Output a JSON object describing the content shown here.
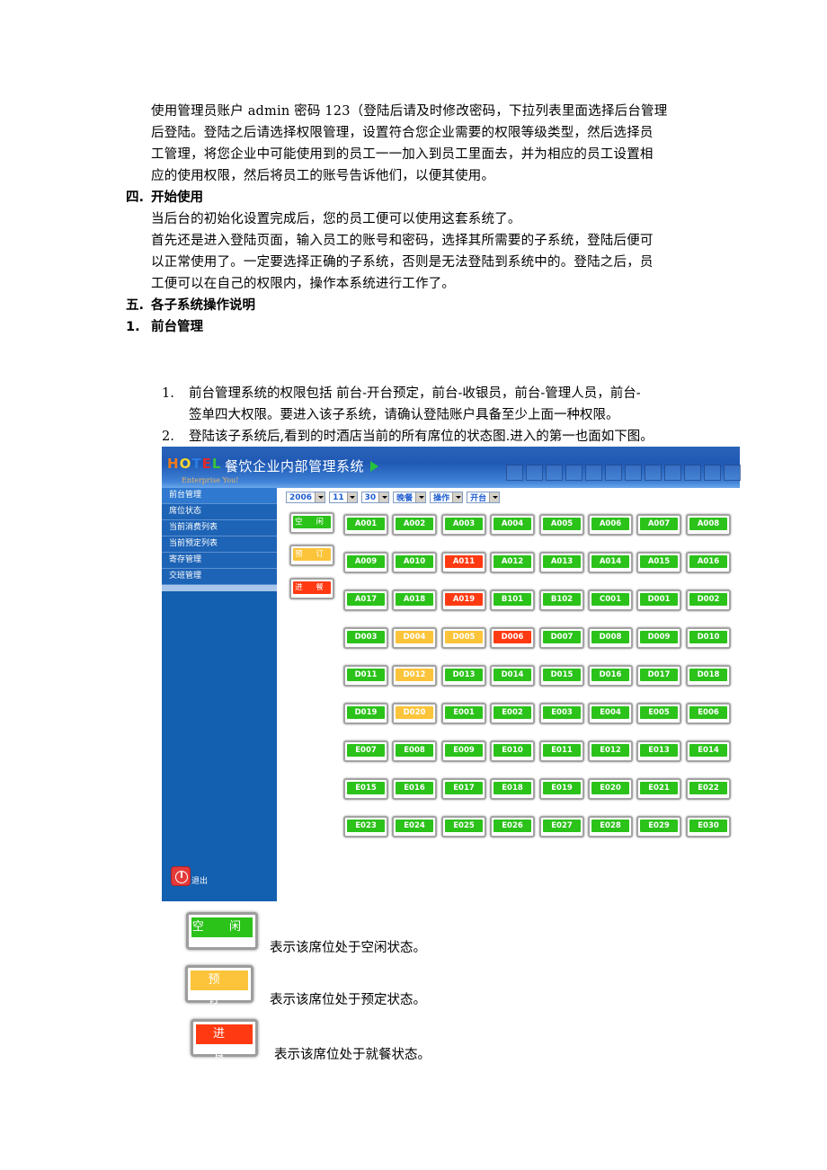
{
  "intro": {
    "lines": [
      "使用管理员账户 admin 密码 123（登陆后请及时修改密码，下拉列表里面选择后台管理",
      "后登陆。登陆之后请选择权限管理，设置符合您企业需要的权限等级类型，然后选择员",
      "工管理，将您企业中可能使用到的员工一一加入到员工里面去，并为相应的员工设置相",
      "应的使用权限，然后将员工的账号告诉他们，以便其使用。"
    ]
  },
  "section4": {
    "number": "四.",
    "title": "开始使用",
    "lines": [
      "当后台的初始化设置完成后，您的员工便可以使用这套系统了。",
      "首先还是进入登陆页面，输入员工的账号和密码，选择其所需要的子系统，登陆后便可",
      "以正常使用了。一定要选择正确的子系统，否则是无法登陆到系统中的。登陆之后，员",
      "工便可以在自己的权限内，操作本系统进行工作了。"
    ]
  },
  "section5": {
    "number": "五.",
    "title": "各子系统操作说明"
  },
  "subsection1": {
    "number": "1.",
    "title": "前台管理"
  },
  "list": [
    {
      "n": "1.",
      "lines": [
        "前台管理系统的权限包括  前台-开台预定，前台-收银员，前台-管理人员，前台-",
        "签单四大权限。要进入该子系统，请确认登陆账户具备至少上面一种权限。"
      ]
    },
    {
      "n": "2.",
      "lines": [
        "登陆该子系统后,看到的时酒店当前的所有席位的状态图.进入的第一也面如下图。"
      ]
    }
  ],
  "app": {
    "logo": [
      "H",
      "O",
      "T",
      "E",
      "L"
    ],
    "tagline": "Enterprise You!",
    "title": "餐饮企业内部管理系统",
    "sidebar": [
      "前台管理",
      "席位状态",
      "当前消费列表",
      "当前预定列表",
      "寄存管理",
      "交班管理"
    ],
    "logout": "退出",
    "toolbar": {
      "year": "2006",
      "month": "11",
      "day": "30",
      "meal": "晚餐",
      "action": "操作",
      "mode": "开台"
    },
    "legend": [
      {
        "label": "空 闲",
        "status": "free"
      },
      {
        "label": "预 订",
        "status": "reserved"
      },
      {
        "label": "进 餐",
        "status": "dining"
      }
    ],
    "colors": {
      "free": "#2bc21a",
      "reserved": "#fcc43a",
      "dining": "#ff3a12"
    },
    "tables": [
      {
        "id": "A001",
        "status": "free"
      },
      {
        "id": "A002",
        "status": "free"
      },
      {
        "id": "A003",
        "status": "free"
      },
      {
        "id": "A004",
        "status": "free"
      },
      {
        "id": "A005",
        "status": "free"
      },
      {
        "id": "A006",
        "status": "free"
      },
      {
        "id": "A007",
        "status": "free"
      },
      {
        "id": "A008",
        "status": "free"
      },
      {
        "id": "A009",
        "status": "free"
      },
      {
        "id": "A010",
        "status": "free"
      },
      {
        "id": "A011",
        "status": "dining"
      },
      {
        "id": "A012",
        "status": "free"
      },
      {
        "id": "A013",
        "status": "free"
      },
      {
        "id": "A014",
        "status": "free"
      },
      {
        "id": "A015",
        "status": "free"
      },
      {
        "id": "A016",
        "status": "free"
      },
      {
        "id": "A017",
        "status": "free"
      },
      {
        "id": "A018",
        "status": "free"
      },
      {
        "id": "A019",
        "status": "dining"
      },
      {
        "id": "B101",
        "status": "free"
      },
      {
        "id": "B102",
        "status": "free"
      },
      {
        "id": "C001",
        "status": "free"
      },
      {
        "id": "D001",
        "status": "free"
      },
      {
        "id": "D002",
        "status": "free"
      },
      {
        "id": "D003",
        "status": "free"
      },
      {
        "id": "D004",
        "status": "reserved"
      },
      {
        "id": "D005",
        "status": "reserved"
      },
      {
        "id": "D006",
        "status": "dining"
      },
      {
        "id": "D007",
        "status": "free"
      },
      {
        "id": "D008",
        "status": "free"
      },
      {
        "id": "D009",
        "status": "free"
      },
      {
        "id": "D010",
        "status": "free"
      },
      {
        "id": "D011",
        "status": "free"
      },
      {
        "id": "D012",
        "status": "reserved"
      },
      {
        "id": "D013",
        "status": "free"
      },
      {
        "id": "D014",
        "status": "free"
      },
      {
        "id": "D015",
        "status": "free"
      },
      {
        "id": "D016",
        "status": "free"
      },
      {
        "id": "D017",
        "status": "free"
      },
      {
        "id": "D018",
        "status": "free"
      },
      {
        "id": "D019",
        "status": "free"
      },
      {
        "id": "D020",
        "status": "reserved"
      },
      {
        "id": "E001",
        "status": "free"
      },
      {
        "id": "E002",
        "status": "free"
      },
      {
        "id": "E003",
        "status": "free"
      },
      {
        "id": "E004",
        "status": "free"
      },
      {
        "id": "E005",
        "status": "free"
      },
      {
        "id": "E006",
        "status": "free"
      },
      {
        "id": "E007",
        "status": "free"
      },
      {
        "id": "E008",
        "status": "free"
      },
      {
        "id": "E009",
        "status": "free"
      },
      {
        "id": "E010",
        "status": "free"
      },
      {
        "id": "E011",
        "status": "free"
      },
      {
        "id": "E012",
        "status": "free"
      },
      {
        "id": "E013",
        "status": "free"
      },
      {
        "id": "E014",
        "status": "free"
      },
      {
        "id": "E015",
        "status": "free"
      },
      {
        "id": "E016",
        "status": "free"
      },
      {
        "id": "E017",
        "status": "free"
      },
      {
        "id": "E018",
        "status": "free"
      },
      {
        "id": "E019",
        "status": "free"
      },
      {
        "id": "E020",
        "status": "free"
      },
      {
        "id": "E021",
        "status": "free"
      },
      {
        "id": "E022",
        "status": "free"
      },
      {
        "id": "E023",
        "status": "free"
      },
      {
        "id": "E024",
        "status": "free"
      },
      {
        "id": "E025",
        "status": "free"
      },
      {
        "id": "E026",
        "status": "free"
      },
      {
        "id": "E027",
        "status": "free"
      },
      {
        "id": "E028",
        "status": "free"
      },
      {
        "id": "E029",
        "status": "free"
      },
      {
        "id": "E030",
        "status": "free"
      }
    ]
  },
  "legend_explanations": [
    {
      "label": "空 闲",
      "status": "free",
      "text": "表示该席位处于空闲状态。"
    },
    {
      "label": "预 订",
      "status": "reserved",
      "text": "表示该席位处于预定状态。"
    },
    {
      "label": "进 餐",
      "status": "dining",
      "text": "表示该席位处于就餐状态。"
    }
  ]
}
